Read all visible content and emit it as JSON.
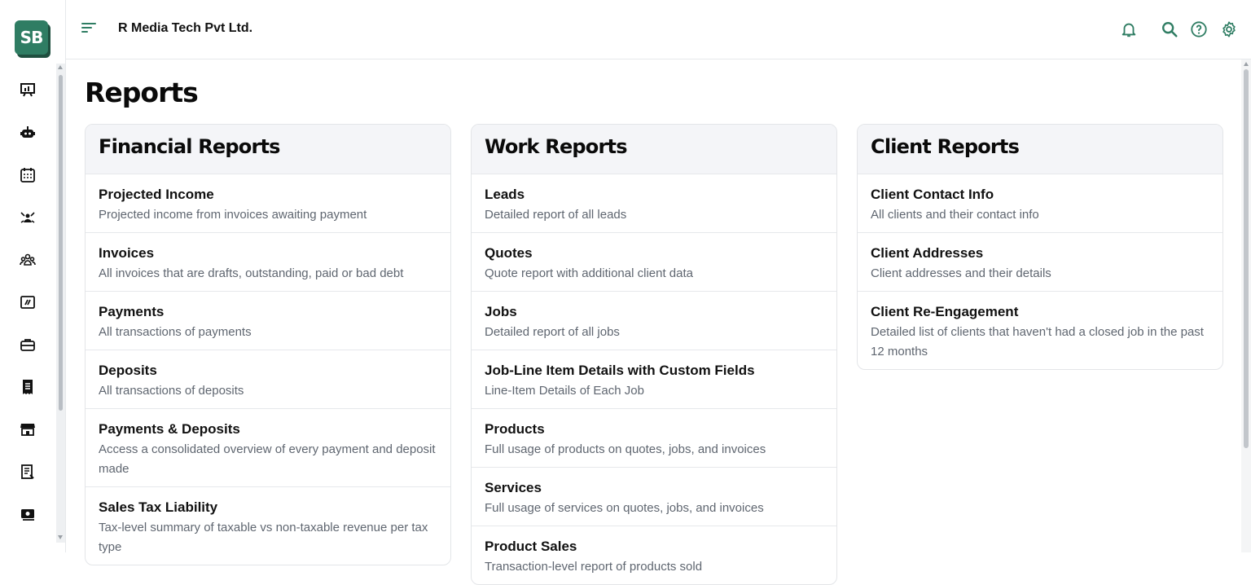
{
  "app": {
    "logo_text": "SB",
    "company_name": "R Media Tech Pvt Ltd."
  },
  "sidebar": {
    "icons": [
      "dashboard-icon",
      "robot-icon",
      "calendar-icon",
      "team-icon",
      "clients-icon",
      "analytics-icon",
      "briefcase-icon",
      "receipt-icon",
      "store-icon",
      "document-icon",
      "money-icon"
    ]
  },
  "topbar": {
    "icons": [
      "bell-icon",
      "search-icon",
      "help-icon",
      "gear-icon"
    ]
  },
  "page": {
    "title": "Reports"
  },
  "colors": {
    "accent": "#2f7d63",
    "card_header_bg": "#f4f5f8",
    "description_text": "#5f6670"
  },
  "sections": [
    {
      "title": "Financial Reports",
      "items": [
        {
          "title": "Projected Income",
          "description": "Projected income from invoices awaiting payment"
        },
        {
          "title": "Invoices",
          "description": "All invoices that are drafts, outstanding, paid or bad debt"
        },
        {
          "title": "Payments",
          "description": "All transactions of payments"
        },
        {
          "title": "Deposits",
          "description": "All transactions of deposits"
        },
        {
          "title": "Payments & Deposits",
          "description": "Access a consolidated overview of every payment and deposit made"
        },
        {
          "title": "Sales Tax Liability",
          "description": "Tax-level summary of taxable vs non-taxable revenue per tax type"
        }
      ]
    },
    {
      "title": "Work Reports",
      "items": [
        {
          "title": "Leads",
          "description": "Detailed report of all leads"
        },
        {
          "title": "Quotes",
          "description": "Quote report with additional client data"
        },
        {
          "title": "Jobs",
          "description": "Detailed report of all jobs"
        },
        {
          "title": "Job-Line Item Details with Custom Fields",
          "description": "Line-Item Details of Each Job"
        },
        {
          "title": "Products",
          "description": "Full usage of products on quotes, jobs, and invoices"
        },
        {
          "title": "Services",
          "description": "Full usage of services on quotes, jobs, and invoices"
        },
        {
          "title": "Product Sales",
          "description": "Transaction-level report of products sold"
        }
      ]
    },
    {
      "title": "Client Reports",
      "items": [
        {
          "title": "Client Contact Info",
          "description": "All clients and their contact info"
        },
        {
          "title": "Client Addresses",
          "description": "Client addresses and their details"
        },
        {
          "title": "Client Re-Engagement",
          "description": "Detailed list of clients that haven't had a closed job in the past 12 months"
        }
      ]
    }
  ]
}
